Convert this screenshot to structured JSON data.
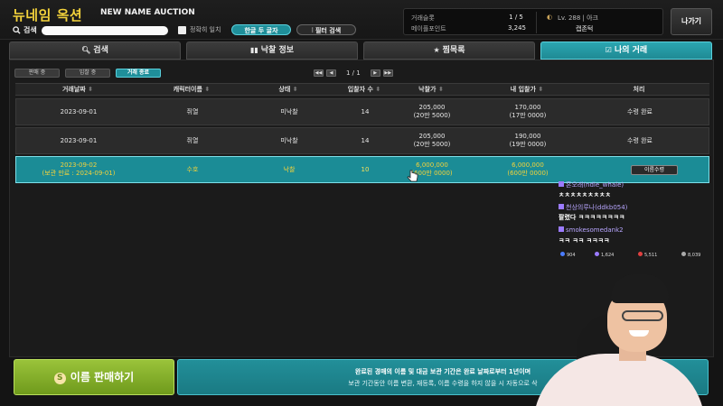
{
  "header": {
    "title": "뉴네임 옥션",
    "subtitle": "NEW NAME AUCTION",
    "search_label": "검색",
    "search_value": "",
    "exact_match_label": "정확히 일치",
    "two_char_button": "한글 두 글자",
    "filter_button": "필터 검색",
    "exit_button": "나가기"
  },
  "account": {
    "trade_count_label": "거래슬롯",
    "trade_count_value": "1 / 5",
    "maple_points_label": "메이플포인트",
    "maple_points_value": "3,245",
    "character_level": "Lv. 288 | 아크",
    "character_name": "캡존턱"
  },
  "tabs": [
    {
      "label": "검색",
      "icon": "search-icon"
    },
    {
      "label": "낙찰 정보",
      "icon": "bar-chart-icon"
    },
    {
      "label": "찜목록",
      "icon": "star-icon"
    },
    {
      "label": "나의 거래",
      "icon": "checkbox-icon",
      "active": true
    }
  ],
  "subtabs": [
    {
      "label": "판매 중"
    },
    {
      "label": "입찰 중"
    },
    {
      "label": "거래 종료",
      "active": true
    }
  ],
  "pager": {
    "first": "◀◀",
    "prev": "◀",
    "text": "1 / 1",
    "next": "▶",
    "last": "▶▶"
  },
  "table": {
    "columns": [
      "거래날짜",
      "캐릭터이름",
      "상태",
      "입찰자 수",
      "낙찰가",
      "내 입찰가",
      "처리"
    ],
    "sort_marker": "⬍",
    "rows": [
      {
        "date": "2023-09-01",
        "date_sub": "",
        "name": "쥐열",
        "status": "미낙찰",
        "bidders": "14",
        "price": "205,000",
        "price_sub": "(20만 5000)",
        "mybid": "170,000",
        "mybid_sub": "(17만 0000)",
        "action": "수령 완료",
        "active": false
      },
      {
        "date": "2023-09-01",
        "date_sub": "",
        "name": "쥐열",
        "status": "미낙찰",
        "bidders": "14",
        "price": "205,000",
        "price_sub": "(20만 5000)",
        "mybid": "190,000",
        "mybid_sub": "(19만 0000)",
        "action": "수령 완료",
        "active": false
      },
      {
        "date": "2023-09-02",
        "date_sub": "(보관 만료 : 2024-09-01)",
        "name": "수호",
        "status": "낙찰",
        "bidders": "10",
        "price": "6,000,000",
        "price_sub": "(600만 0000)",
        "mybid": "6,000,000",
        "mybid_sub": "(600만 0000)",
        "action": "이름수령",
        "active": true
      }
    ]
  },
  "sell_button": "이름 판매하기",
  "notice": {
    "line1": "완료된 경매의 이름 및 대금 보관 기간은 완료 날짜로부터 1년이며",
    "line2": "보관 기간동안 이름 변환, 재등록, 이름 수령을 하지 않을 시 자동으로 삭"
  },
  "chat": [
    {
      "user": "혼오래(ndle_whale)",
      "text": "ㅊㅊㅊㅊㅊㅊㅊㅊㅊ"
    },
    {
      "user": "천상의루나(ddkb054)",
      "text": "팔렸다 ㅋㅋㅋㅋㅋㅋㅋㅋ"
    },
    {
      "user": "smokesomedank2",
      "text": "ㅋㅋ ㅋㅋ ㅋㅋㅋㅋ"
    }
  ],
  "stream_stats": [
    "904",
    "1,624",
    "5,511",
    "8,039"
  ]
}
